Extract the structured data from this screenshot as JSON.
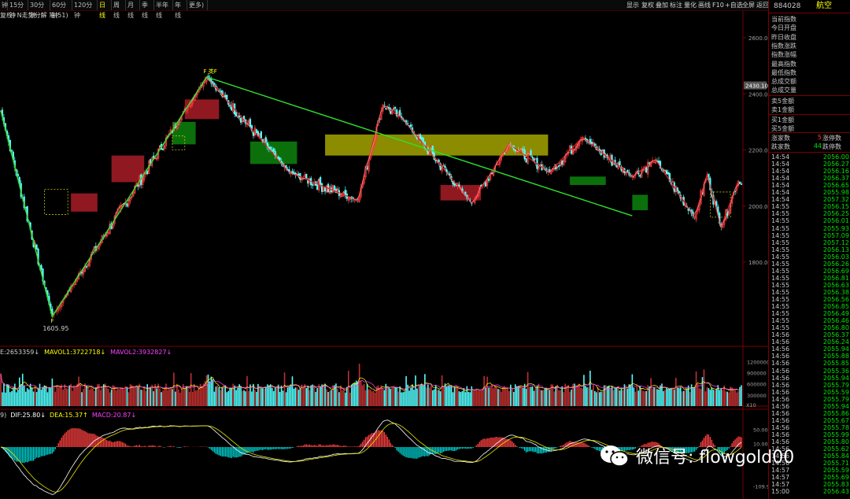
{
  "toolbar": {
    "periods": [
      "钟",
      "15分钟",
      "30分钟",
      "60分钟",
      "120分钟",
      "日线",
      "周线",
      "月线",
      "季线",
      "半年线",
      "年线",
      "更多)"
    ],
    "active_period": "日线",
    "buttons": [
      "显示",
      "复权",
      "叠加",
      "标注",
      "量化",
      "画线",
      "F10",
      "+自选",
      "全屏",
      "返回"
    ]
  },
  "subtitle": "复权) N走势分解 笔(51)",
  "instrument": {
    "code": "884028",
    "name": "航空"
  },
  "info_labels": [
    "当前指数",
    "今日开盘",
    "昨日收盘",
    "指数涨跌",
    "指数涨幅",
    "最高指数",
    "最低指数",
    "总成交额",
    "总成交量"
  ],
  "order_labels_sell": [
    "卖5金额",
    "卖1金额"
  ],
  "order_labels_buy": [
    "买1金额",
    "买5金额"
  ],
  "breadth": {
    "up_label": "涨家数",
    "up": "5",
    "limit_up_label": "涨停数",
    "down_label": "跌家数",
    "down": "44",
    "limit_down_label": "跌停数"
  },
  "ticks": [
    [
      "14:54",
      "2056.00"
    ],
    [
      "14:54",
      "2056.27"
    ],
    [
      "14:54",
      "2056.16"
    ],
    [
      "14:54",
      "2056.37"
    ],
    [
      "14:54",
      "2056.65"
    ],
    [
      "14:54",
      "2055.98"
    ],
    [
      "14:54",
      "2057.32"
    ],
    [
      "14:55",
      "2056.15"
    ],
    [
      "14:55",
      "2056.25"
    ],
    [
      "14:55",
      "2056.01"
    ],
    [
      "14:55",
      "2055.93"
    ],
    [
      "14:55",
      "2057.09"
    ],
    [
      "14:55",
      "2057.12"
    ],
    [
      "14:55",
      "2056.13"
    ],
    [
      "14:55",
      "2056.03"
    ],
    [
      "14:55",
      "2056.26"
    ],
    [
      "14:55",
      "2056.69"
    ],
    [
      "14:55",
      "2056.81"
    ],
    [
      "14:55",
      "2056.63"
    ],
    [
      "14:55",
      "2056.38"
    ],
    [
      "14:55",
      "2056.56"
    ],
    [
      "14:55",
      "2056.85"
    ],
    [
      "14:55",
      "2056.49"
    ],
    [
      "14:55",
      "2056.46"
    ],
    [
      "14:55",
      "2056.80"
    ],
    [
      "14:56",
      "2056.37"
    ],
    [
      "14:56",
      "2056.24"
    ],
    [
      "14:56",
      "2055.94"
    ],
    [
      "14:56",
      "2055.88"
    ],
    [
      "14:56",
      "2055.85"
    ],
    [
      "14:56",
      "2055.36"
    ],
    [
      "14:56",
      "2055.94"
    ],
    [
      "14:56",
      "2055.79"
    ],
    [
      "14:56",
      "2055.59"
    ],
    [
      "14:56",
      "2055.79"
    ],
    [
      "14:56",
      "2055.94"
    ],
    [
      "14:56",
      "2055.86"
    ],
    [
      "14:56",
      "2055.67"
    ],
    [
      "14:56",
      "2055.78"
    ],
    [
      "14:56",
      "2055.99"
    ],
    [
      "14:56",
      "2055.80"
    ],
    [
      "14:56",
      "2055.62"
    ],
    [
      "14:56",
      "2055.84"
    ],
    [
      "14:56",
      "2055.71"
    ],
    [
      "14:57",
      "2055.59"
    ],
    [
      "14:57",
      "2055.69"
    ],
    [
      "14:57",
      "2055.83"
    ],
    [
      "15:00",
      "2056.43"
    ]
  ],
  "price_axis": {
    "labels": [
      "2600.00",
      "2400.00",
      "2200.00",
      "2000.00",
      "1800.00"
    ],
    "current_tag": "2430.10"
  },
  "volume_axis": {
    "labels": [
      "1200000",
      "900000",
      "600000",
      "300000"
    ],
    "unit": "X10"
  },
  "macd_axis": {
    "labels": [
      "50.00",
      "10.00",
      "-109.99"
    ]
  },
  "low_label": "1605.95",
  "volume_legend": {
    "vol": "E:2653359↓",
    "mavol1": "MAVOL1:3722718↓",
    "mavol2": "MAVOL2:3932827↓"
  },
  "macd_legend": {
    "prefix": "9)",
    "dif": "DIF:25.80↓",
    "dea": "DEA:15.37↑",
    "macd": "MACD:20.87↓"
  },
  "watermark": "微信号: flowgold00",
  "colors": {
    "up": "#ff3c3c",
    "down": "#54ffff",
    "zhongshu_red": "#b41e28",
    "zhongshu_green": "#0e8c0e",
    "zhongshu_yellow": "#a5a500",
    "trend_line": "#2ee02e",
    "stroke": "#e61e1e",
    "dif": "#ffffff",
    "dea": "#e6e600",
    "macd_pos": "#ff4040",
    "macd_neg": "#00d0d0"
  },
  "chart_data": {
    "type": "candlestick",
    "y_axis": [
      1500,
      2700
    ],
    "labels": {
      "top": [
        "F 类F"
      ],
      "bottom": [
        "F"
      ]
    },
    "pivots": [
      {
        "bar": 0,
        "price": 2340
      },
      {
        "bar": 33,
        "price": 1606
      },
      {
        "bar": 132,
        "price": 2460
      },
      {
        "bar": 185,
        "price": 2120
      },
      {
        "bar": 229,
        "price": 2020
      },
      {
        "bar": 245,
        "price": 2360
      },
      {
        "bar": 258,
        "price": 2310
      },
      {
        "bar": 302,
        "price": 2010
      },
      {
        "bar": 326,
        "price": 2220
      },
      {
        "bar": 352,
        "price": 2120
      },
      {
        "bar": 373,
        "price": 2245
      },
      {
        "bar": 405,
        "price": 2105
      },
      {
        "bar": 420,
        "price": 2165
      },
      {
        "bar": 445,
        "price": 1960
      },
      {
        "bar": 453,
        "price": 2110
      },
      {
        "bar": 462,
        "price": 1925
      },
      {
        "bar": 473,
        "price": 2090
      }
    ],
    "trend_lines": [
      [
        0,
        2340
      ],
      [
        33,
        1606
      ],
      [
        132,
        2460
      ],
      [
        405,
        1965
      ]
    ],
    "zhongshu_boxes": [
      {
        "from": 71,
        "to": 92,
        "low": 2085,
        "high": 2180,
        "color": "red"
      },
      {
        "from": 45,
        "to": 62,
        "low": 1980,
        "high": 2045,
        "color": "red"
      },
      {
        "from": 110,
        "to": 125,
        "low": 2220,
        "high": 2300,
        "color": "green"
      },
      {
        "from": 118,
        "to": 140,
        "low": 2310,
        "high": 2380,
        "color": "red"
      },
      {
        "from": 160,
        "to": 190,
        "low": 2150,
        "high": 2230,
        "color": "green"
      },
      {
        "from": 208,
        "to": 351,
        "low": 2180,
        "high": 2255,
        "color": "yellow"
      },
      {
        "from": 282,
        "to": 308,
        "low": 2020,
        "high": 2075,
        "color": "red"
      },
      {
        "from": 365,
        "to": 388,
        "low": 2075,
        "high": 2105,
        "color": "green"
      },
      {
        "from": 405,
        "to": 415,
        "low": 1985,
        "high": 2040,
        "color": "green"
      }
    ]
  }
}
